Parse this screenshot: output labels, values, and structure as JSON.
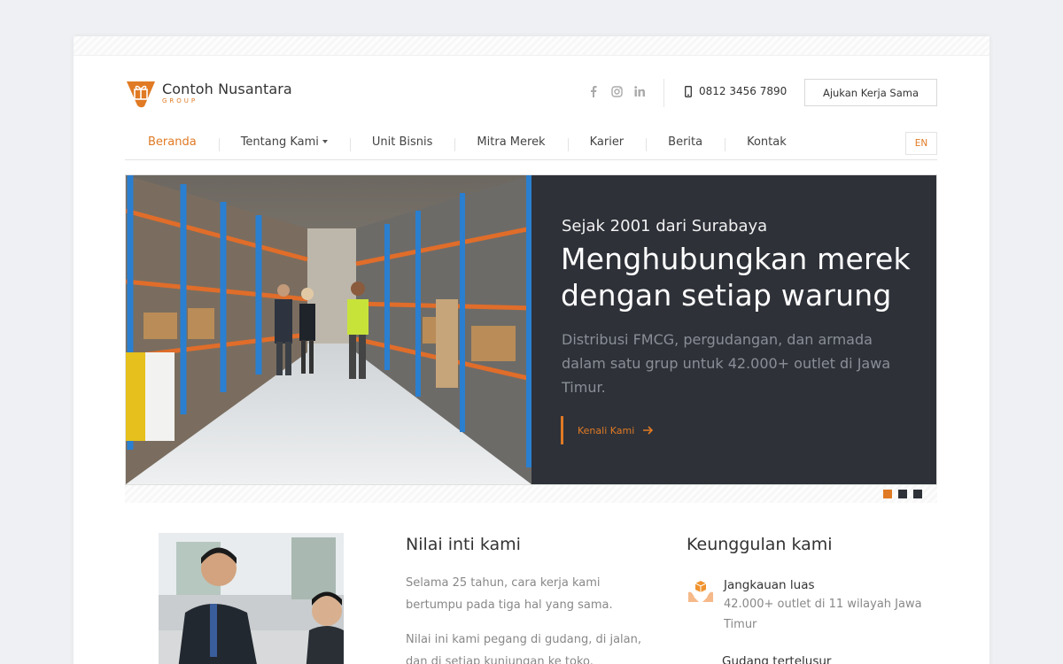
{
  "brand": {
    "name": "Contoh Nusantara",
    "sub": "GROUP",
    "accent": "#e07a24",
    "dark": "#2e3138"
  },
  "header": {
    "social": [
      "facebook-icon",
      "instagram-icon",
      "linkedin-icon"
    ],
    "phone": "0812 3456 7890",
    "cta_label": "Ajukan Kerja Sama"
  },
  "nav": {
    "items": [
      {
        "label": "Beranda",
        "active": true
      },
      {
        "label": "Tentang Kami",
        "dropdown": true
      },
      {
        "label": "Unit Bisnis"
      },
      {
        "label": "Mitra Merek"
      },
      {
        "label": "Karier"
      },
      {
        "label": "Berita"
      },
      {
        "label": "Kontak"
      }
    ],
    "lang": "EN"
  },
  "hero": {
    "eyebrow": "Sejak 2001 dari Surabaya",
    "headline": "Menghubungkan merek dengan setiap warung",
    "lead": "Distribusi FMCG, pergudangan, dan armada dalam satu grup untuk 42.000+ outlet di Jawa Timur.",
    "link_label": "Kenali Kami",
    "slides": 3,
    "active_slide": 1
  },
  "values": {
    "title": "Nilai inti kami",
    "p1": "Selama 25 tahun, cara kerja kami bertumpu pada tiga hal yang sama.",
    "p2": "Nilai ini kami pegang di gudang, di jalan, dan di setiap kunjungan ke toko."
  },
  "advantages": {
    "title": "Keunggulan kami",
    "items": [
      {
        "title": "Jangkauan luas",
        "desc": "42.000+ outlet di 11 wilayah Jawa Timur",
        "icon": "hand-box-icon"
      },
      {
        "title": "Gudang tertelusur"
      }
    ]
  }
}
